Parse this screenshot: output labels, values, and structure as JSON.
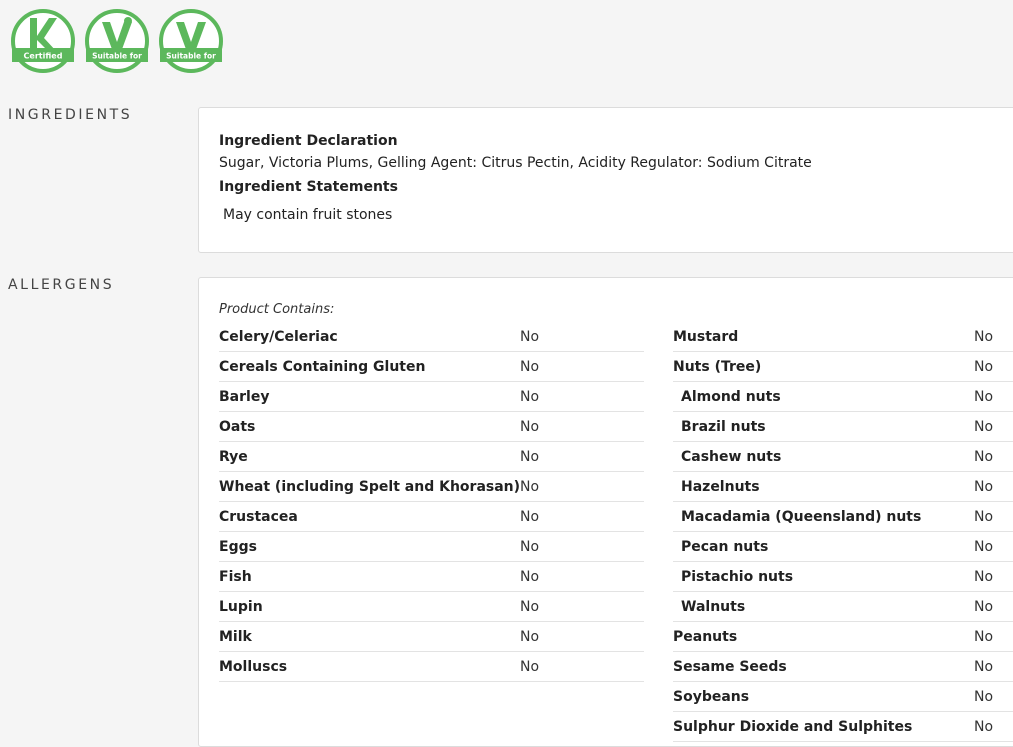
{
  "badges": [
    {
      "icon": "kosher-certified-icon",
      "label": "Certified",
      "color": "#5cb85c"
    },
    {
      "icon": "suitable-for-vegetarians-icon",
      "label": "Suitable for",
      "color": "#5cb85c"
    },
    {
      "icon": "suitable-for-vegans-icon",
      "label": "Suitable for",
      "color": "#5cb85c"
    }
  ],
  "ingredients": {
    "section_title": "INGREDIENTS",
    "declaration_heading": "Ingredient Declaration",
    "declaration_text": "Sugar, Victoria Plums, Gelling Agent: Citrus Pectin, Acidity Regulator: Sodium Citrate",
    "statements_heading": "Ingredient Statements",
    "statements_text": "May contain fruit stones"
  },
  "allergens": {
    "section_title": "ALLERGENS",
    "contains_label": "Product Contains:",
    "left": [
      {
        "name": "Celery/Celeriac",
        "value": "No"
      },
      {
        "name": "Cereals Containing Gluten",
        "value": "No"
      },
      {
        "name": "Barley",
        "value": "No"
      },
      {
        "name": "Oats",
        "value": "No"
      },
      {
        "name": "Rye",
        "value": "No"
      },
      {
        "name": "Wheat (including Spelt and Khorasan)",
        "value": "No"
      },
      {
        "name": "Crustacea",
        "value": "No"
      },
      {
        "name": "Eggs",
        "value": "No"
      },
      {
        "name": "Fish",
        "value": "No"
      },
      {
        "name": "Lupin",
        "value": "No"
      },
      {
        "name": "Milk",
        "value": "No"
      },
      {
        "name": "Molluscs",
        "value": "No"
      }
    ],
    "right": [
      {
        "name": "Mustard",
        "value": "No",
        "sub": false
      },
      {
        "name": "Nuts (Tree)",
        "value": "No",
        "sub": false
      },
      {
        "name": "Almond nuts",
        "value": "No",
        "sub": true
      },
      {
        "name": "Brazil nuts",
        "value": "No",
        "sub": true
      },
      {
        "name": "Cashew nuts",
        "value": "No",
        "sub": true
      },
      {
        "name": "Hazelnuts",
        "value": "No",
        "sub": true
      },
      {
        "name": "Macadamia (Queensland) nuts",
        "value": "No",
        "sub": true
      },
      {
        "name": "Pecan nuts",
        "value": "No",
        "sub": true
      },
      {
        "name": "Pistachio nuts",
        "value": "No",
        "sub": true
      },
      {
        "name": "Walnuts",
        "value": "No",
        "sub": true
      },
      {
        "name": "Peanuts",
        "value": "No",
        "sub": false
      },
      {
        "name": "Sesame Seeds",
        "value": "No",
        "sub": false
      },
      {
        "name": "Soybeans",
        "value": "No",
        "sub": false
      },
      {
        "name": "Sulphur Dioxide and Sulphites",
        "value": "No",
        "sub": false
      }
    ]
  }
}
